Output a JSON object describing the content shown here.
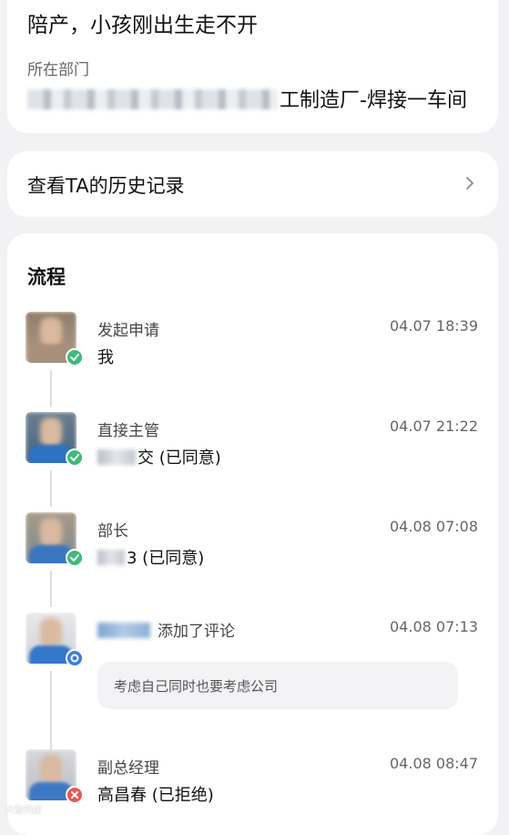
{
  "request": {
    "reason": "陪产，小孩刚出生走不开",
    "department_label": "所在部门",
    "department_value": "工制造厂-焊接一车间"
  },
  "history_link": {
    "label": "查看TA的历史记录"
  },
  "flow": {
    "title": "流程",
    "steps": [
      {
        "role": "发起申请",
        "person": "我",
        "time": "04.07 18:39",
        "status": "approved"
      },
      {
        "role": "直接主管",
        "person": "交 (已同意)",
        "time": "04.07 21:22",
        "status": "approved"
      },
      {
        "role": "部长",
        "person": "3 (已同意)",
        "time": "04.08 07:08",
        "status": "approved"
      },
      {
        "action": "添加了评论",
        "comment": "考虑自己同时也要考虑公司",
        "time": "04.08 07:13",
        "status": "commented"
      },
      {
        "role": "副总经理",
        "person": "高昌春 (已拒绝)",
        "time": "04.08 08:47",
        "status": "rejected"
      }
    ]
  },
  "colors": {
    "approved": "#3dbb7b",
    "commented": "#3b7fe0",
    "rejected": "#e45a57"
  },
  "icons": {
    "history_chevron": "chevron-right-icon",
    "approved_badge": "check-icon",
    "comment_badge": "ring-icon",
    "rejected_badge": "x-icon"
  },
  "watermark": "大型药店"
}
